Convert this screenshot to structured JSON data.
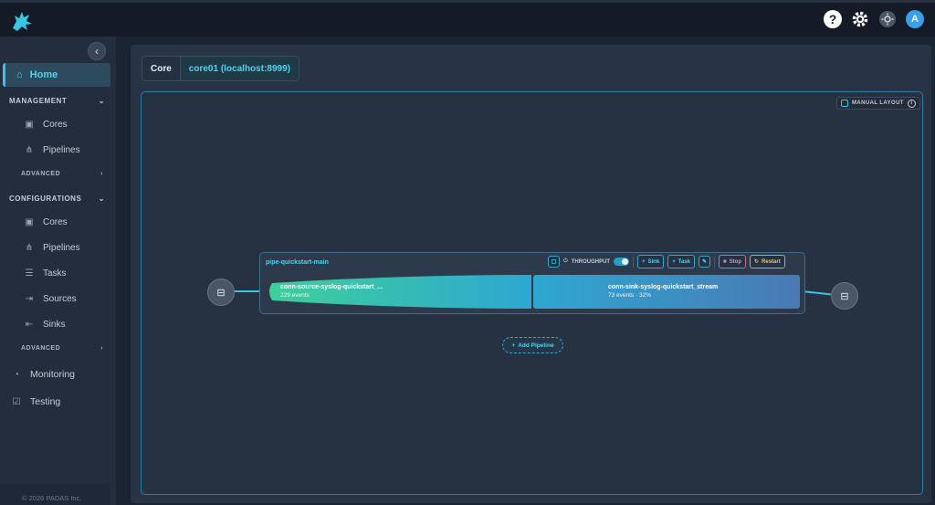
{
  "topbar": {
    "help_icon": "?",
    "avatar_initial": "A"
  },
  "sidebar": {
    "home": "Home",
    "management": {
      "label": "MANAGEMENT",
      "items": [
        "Cores",
        "Pipelines"
      ],
      "advanced": "ADVANCED"
    },
    "configurations": {
      "label": "CONFIGURATIONS",
      "items": [
        "Cores",
        "Pipelines",
        "Tasks",
        "Sources",
        "Sinks"
      ],
      "advanced": "ADVANCED"
    },
    "monitoring": "Monitoring",
    "testing": "Testing",
    "copyright": "© 2026 PADAS Inc."
  },
  "main": {
    "core_label": "Core",
    "core_value": "core01 (localhost:8999)",
    "manual_layout": "MANUAL LAYOUT",
    "pipeline": {
      "name": "pipe-quickstart-main",
      "throughput_label": "THROUGHPUT",
      "sink_btn": "Sink",
      "task_btn": "Task",
      "stop_btn": "Stop",
      "restart_btn": "Restart",
      "source": {
        "name": "conn-source-syslog-quickstart_...",
        "events": "229 events"
      },
      "sink": {
        "name": "conn-sink-syslog-quickstart_stream",
        "events": "73 events · 32%"
      }
    },
    "add_pipeline": "Add Pipeline"
  },
  "colors": {
    "accent": "#38c6e4",
    "source_flow": "#3ecf9a",
    "sink_flow": "#4a79b4",
    "stop": "#e98aa8",
    "restart": "#f0c25a"
  }
}
